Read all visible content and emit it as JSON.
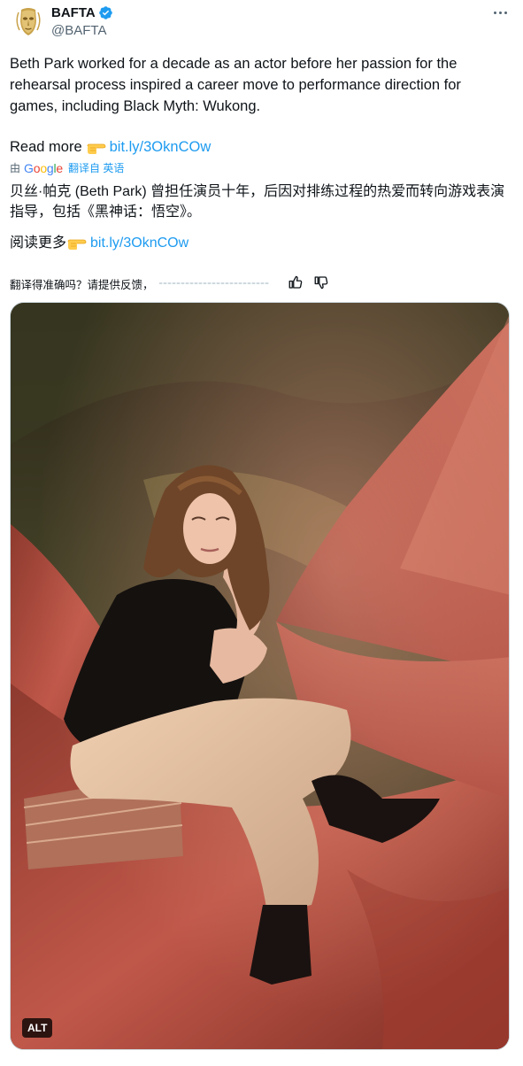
{
  "account": {
    "display_name": "BAFTA",
    "handle": "@BAFTA",
    "verified": true,
    "avatar_icon": "bafta-mask-logo",
    "verified_icon": "verified-badge-icon",
    "more_icon": "more-options-icon"
  },
  "tweet": {
    "text": "Beth Park worked for a decade as an actor before her passion for the rehearsal process inspired a career move to performance direction for games, including Black Myth: Wukong.",
    "read_more_label": "Read more",
    "pointing_icon": "backhand-index-pointing-right-emoji",
    "link": "bit.ly/3OknCOw"
  },
  "translation": {
    "by_label": "由",
    "provider": "Google",
    "source_label": "翻译自 英语",
    "text": "贝丝·帕克 (Beth Park) 曾担任演员十年，后因对排练过程的热爱而转向游戏表演指导，包括《黑神话：悟空》。",
    "read_more_label": "阅读更多",
    "link": "bit.ly/3OknCOw",
    "feedback_prompt": "翻译得准确吗？请提供反馈，",
    "thumbs_up_icon": "thumbs-up-icon",
    "thumbs_down_icon": "thumbs-down-icon"
  },
  "media": {
    "alt_label": "ALT",
    "colors": {
      "fabric_red": "#b2473a",
      "backdrop_olive": "#4b4a2c",
      "shadow": "#1f140e"
    }
  },
  "colors": {
    "accent": "#1d9bf0",
    "text": "#0f1419",
    "muted": "#536471"
  }
}
